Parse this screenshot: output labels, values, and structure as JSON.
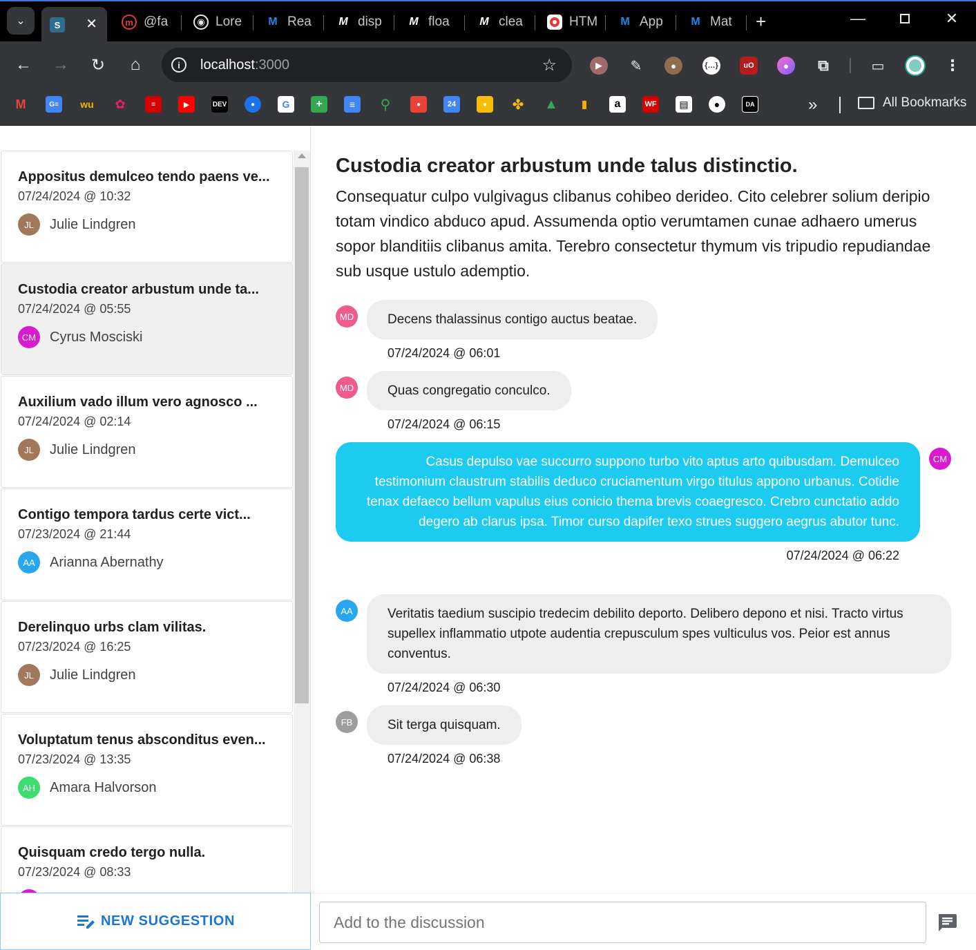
{
  "browser": {
    "tabs": [
      {
        "label": "S",
        "active": true
      },
      {
        "label": "@fa"
      },
      {
        "label": "Lore"
      },
      {
        "label": "Rea"
      },
      {
        "label": "disp"
      },
      {
        "label": "floa"
      },
      {
        "label": "clea"
      },
      {
        "label": "HTM"
      },
      {
        "label": "App"
      },
      {
        "label": "Mat"
      }
    ],
    "url_host": "localhost",
    "url_port": ":3000",
    "all_bookmarks": "All Bookmarks",
    "bookmark_labels": {
      "dev": "DEV",
      "wf": "WF",
      "cal": "24"
    }
  },
  "sidebar": {
    "items": [
      {
        "title": "Appositus demulceo tendo paens ve...",
        "date": "07/24/2024 @ 10:32",
        "initials": "JL",
        "author": "Julie Lindgren",
        "color": "#a1785b"
      },
      {
        "title": "Custodia creator arbustum unde ta...",
        "date": "07/24/2024 @ 05:55",
        "initials": "CM",
        "author": "Cyrus Mosciski",
        "color": "#d81bd0"
      },
      {
        "title": "Auxilium vado illum vero agnosco ...",
        "date": "07/24/2024 @ 02:14",
        "initials": "JL",
        "author": "Julie Lindgren",
        "color": "#a1785b"
      },
      {
        "title": "Contigo tempora tardus certe vict...",
        "date": "07/23/2024 @ 21:44",
        "initials": "AA",
        "author": "Arianna Abernathy",
        "color": "#29a7ee"
      },
      {
        "title": "Derelinquo urbs clam vilitas.",
        "date": "07/23/2024 @ 16:25",
        "initials": "JL",
        "author": "Julie Lindgren",
        "color": "#a1785b"
      },
      {
        "title": "Voluptatum tenus absconditus even...",
        "date": "07/23/2024 @ 13:35",
        "initials": "AH",
        "author": "Amara Halvorson",
        "color": "#3ddc6e"
      },
      {
        "title": "Quisquam credo tergo nulla.",
        "date": "07/23/2024 @ 08:33",
        "initials": "",
        "author": "",
        "color": "#d81bd0"
      }
    ],
    "new_button_label": "NEW SUGGESTION"
  },
  "main": {
    "title": "Custodia creator arbustum unde talus distinctio.",
    "body": "Consequatur culpo vulgivagus clibanus cohibeo derideo. Cito celebrer solium deripio totam vindico abduco apud. Assumenda optio verumtamen cunae adhaero umerus sopor blanditiis clibanus amita. Terebro consectetur thymum vis tripudio repudiandae sub usque ustulo ademptio.",
    "messages": [
      {
        "initials": "MD",
        "color": "#ef5b8c",
        "text": "Decens thalassinus contigo auctus beatae.",
        "time": "07/24/2024 @ 06:01",
        "mine": false
      },
      {
        "initials": "MD",
        "color": "#ef5b8c",
        "text": "Quas congregatio conculco.",
        "time": "07/24/2024 @ 06:15",
        "mine": false
      },
      {
        "initials": "CM",
        "color": "#d81bd0",
        "text": "Casus depulso vae succurro suppono turbo vito aptus arto quibusdam. Demulceo testimonium claustrum stabilis deduco cruciamentum virgo titulus appono urbanus. Cotidie tenax defaeco bellum vapulus eius conicio thema brevis coaegresco. Crebro cunctatio addo degero ab clarus ipsa. Timor curso dapifer texo strues suggero aegrus abutor tunc.",
        "time": "07/24/2024 @ 06:22",
        "mine": true
      },
      {
        "initials": "AA",
        "color": "#29a7ee",
        "text": "Veritatis taedium suscipio tredecim debilito deporto. Delibero depono et nisi. Tracto virtus supellex inflammatio utpote audentia crepusculum spes vulticulus vos. Peior est annus conventus.",
        "time": "07/24/2024 @ 06:30",
        "mine": false
      },
      {
        "initials": "FB",
        "color": "#9e9e9e",
        "text": "Sit terga quisquam.",
        "time": "07/24/2024 @ 06:38",
        "mine": false
      }
    ],
    "compose_placeholder": "Add to the discussion"
  }
}
